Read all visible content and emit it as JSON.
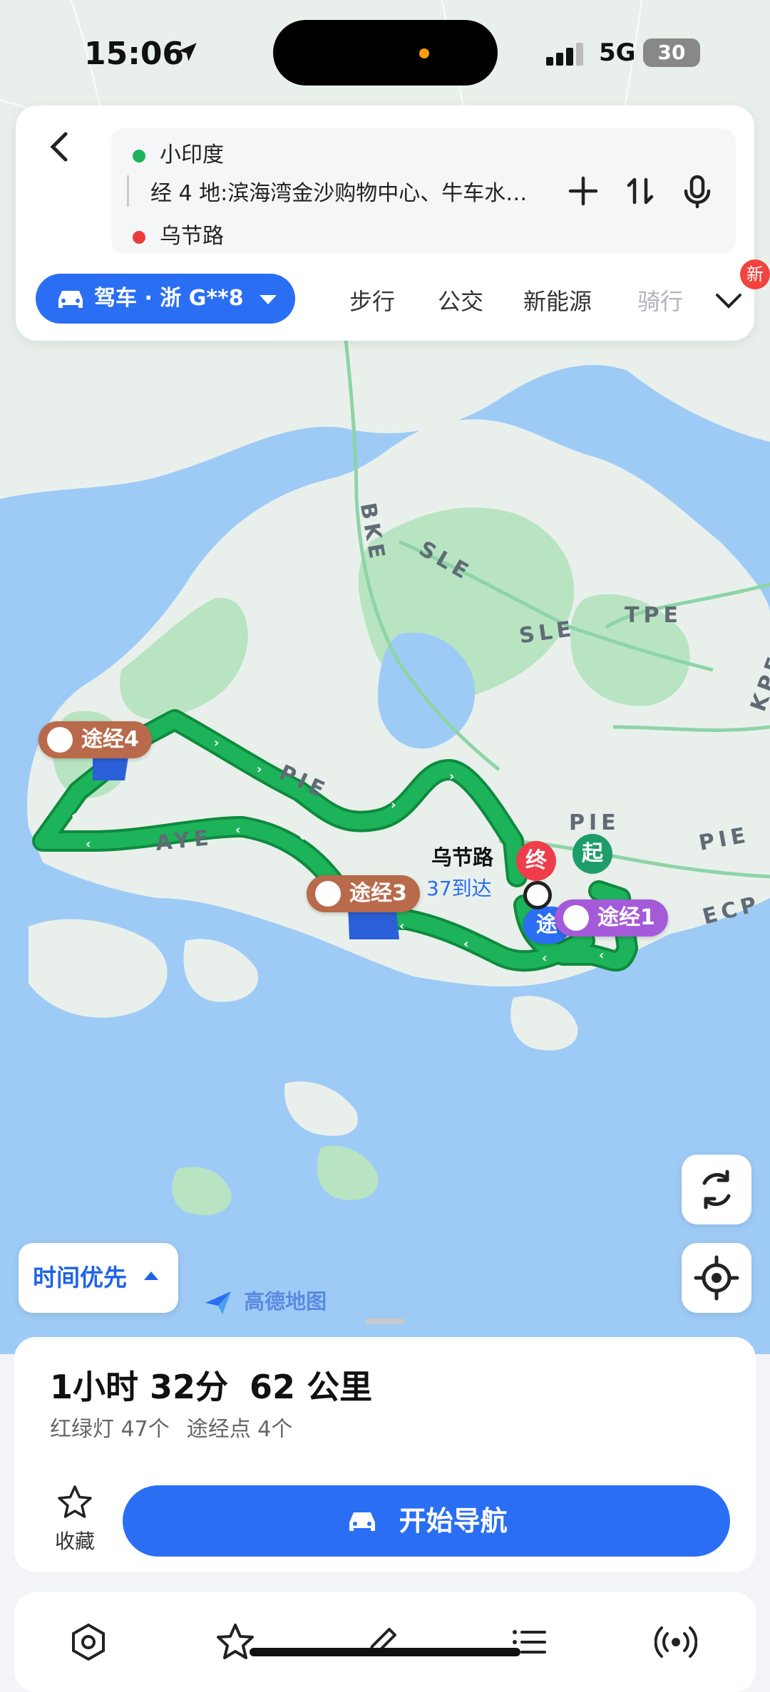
{
  "status_bar": {
    "time": "15:06",
    "network": "5G",
    "battery": "30"
  },
  "search": {
    "origin": "小印度",
    "waypoints_text": "经 4 地:滨海湾金沙购物中心、牛车水…",
    "destination": "乌节路"
  },
  "modes": {
    "drive_label": "驾车 · 浙 G**8",
    "walk": "步行",
    "transit": "公交",
    "new_energy": "新能源",
    "ride": "骑行",
    "new_badge": "新"
  },
  "map": {
    "road_labels": [
      "BKE",
      "SLE",
      "SLE",
      "TPE",
      "PIE",
      "AYE",
      "PIE",
      "PIE",
      "ECP",
      "KPE"
    ],
    "destination_label": "乌节路",
    "eta_label": "37到达",
    "start_marker": "起",
    "end_marker": "终",
    "waypoint_labels": [
      "途经1",
      "途经3",
      "途经4",
      "途"
    ],
    "priority_label": "时间优先",
    "logo_text": "高德地图",
    "colors": {
      "route": "#1db35a",
      "route_outline": "#0e8a3e",
      "water": "#9ecbf6",
      "land": "#e9f0ec",
      "park": "#b9e4c2"
    }
  },
  "summary": {
    "duration": "1小时 32分",
    "distance": "62 公里",
    "traffic_lights": "红绿灯 47个",
    "waypoints": "途经点 4个"
  },
  "actions": {
    "favorite": "收藏",
    "start_nav": "开始导航"
  }
}
